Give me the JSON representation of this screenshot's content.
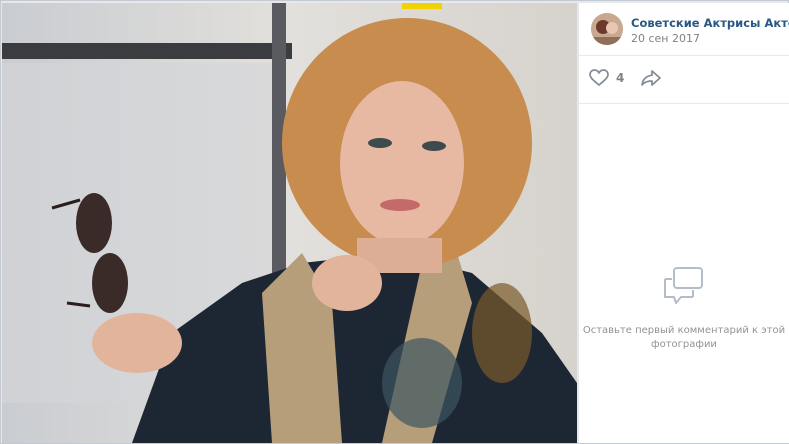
{
  "post": {
    "author": "Советские Актрисы Актёры Кино",
    "date": "20 сен 2017"
  },
  "actions": {
    "like_count": "4",
    "like_icon": "heart-icon",
    "share_icon": "share-icon"
  },
  "comments": {
    "empty_line1": "Оставьте первый комментарий к этой",
    "empty_line2": "фотографии"
  },
  "colors": {
    "link": "#2a5885",
    "muted": "#939393",
    "border": "#e7e8ec"
  }
}
